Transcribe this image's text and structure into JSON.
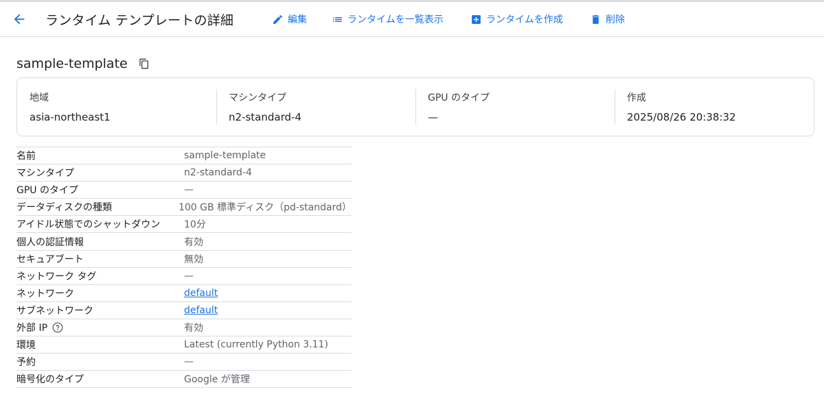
{
  "toolbar": {
    "title": "ランタイム テンプレートの詳細",
    "edit_label": "編集",
    "list_label": "ランタイムを一覧表示",
    "create_label": "ランタイムを作成",
    "delete_label": "削除",
    "accent_color": "#1a73e8"
  },
  "header": {
    "name": "sample-template"
  },
  "summary": [
    {
      "label": "地域",
      "value": "asia-northeast1"
    },
    {
      "label": "マシンタイプ",
      "value": "n2-standard-4"
    },
    {
      "label": "GPU のタイプ",
      "value": "—"
    },
    {
      "label": "作成",
      "value": "2025/08/26 20:38:32"
    }
  ],
  "details": [
    {
      "key": "名前",
      "value": "sample-template"
    },
    {
      "key": "マシンタイプ",
      "value": "n2-standard-4"
    },
    {
      "key": "GPU のタイプ",
      "value": "—"
    },
    {
      "key": "データディスクの種類",
      "value": "100 GB 標準ディスク（pd-standard）"
    },
    {
      "key": "アイドル状態でのシャットダウン",
      "value": "10分"
    },
    {
      "key": "個人の認証情報",
      "value": "有効"
    },
    {
      "key": "セキュアブート",
      "value": "無効"
    },
    {
      "key": "ネットワーク タグ",
      "value": "—"
    },
    {
      "key": "ネットワーク",
      "value": "default"
    },
    {
      "key": "サブネットワーク",
      "value": "default"
    },
    {
      "key": "外部 IP",
      "value": "有効"
    },
    {
      "key": "環境",
      "value": "Latest (currently Python 3.11)"
    },
    {
      "key": "予約",
      "value": "—"
    },
    {
      "key": "暗号化のタイプ",
      "value": "Google が管理"
    }
  ]
}
